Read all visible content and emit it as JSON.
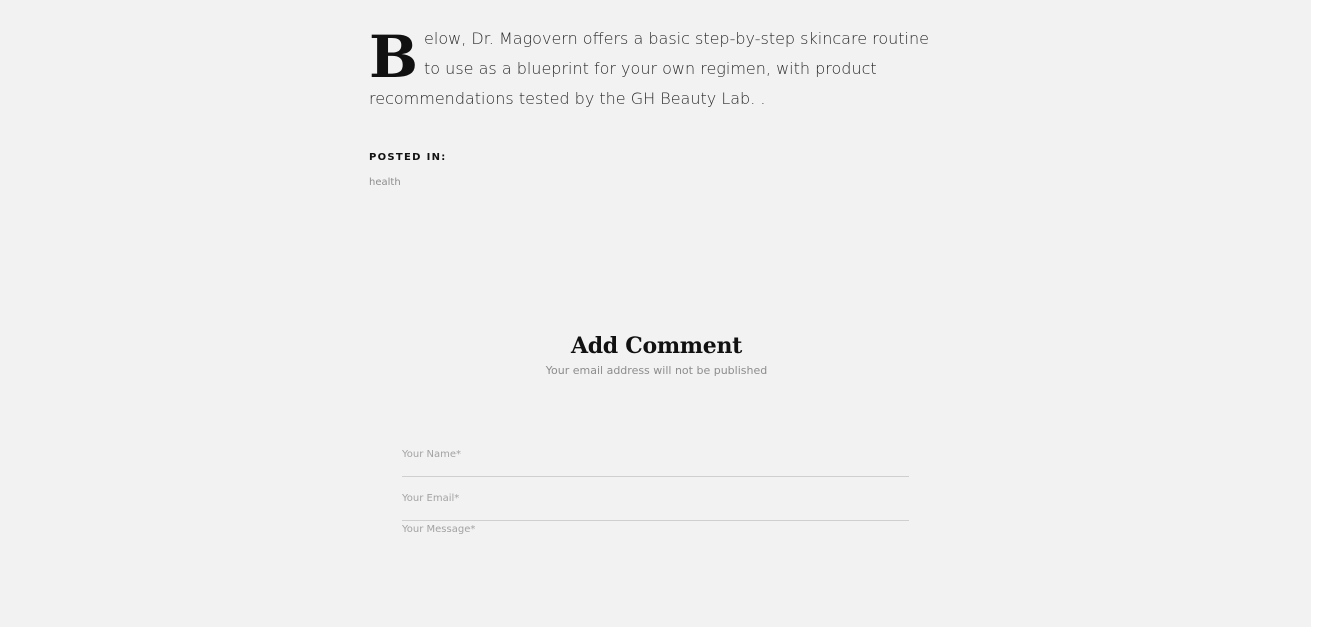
{
  "article": {
    "drop_cap": "B",
    "paragraph": "elow, Dr. Magovern offers a basic step-by-step skincare routine to use as a blueprint for your own regimen, with product recommendations tested by the GH Beauty Lab. ."
  },
  "posted_in": {
    "label": "POSTED IN:",
    "category": "health"
  },
  "comments": {
    "title": "Add Comment",
    "subtitle": "Your email address will not be published",
    "name_placeholder": "Your Name*",
    "email_placeholder": "Your Email*",
    "message_placeholder": "Your Message*"
  }
}
